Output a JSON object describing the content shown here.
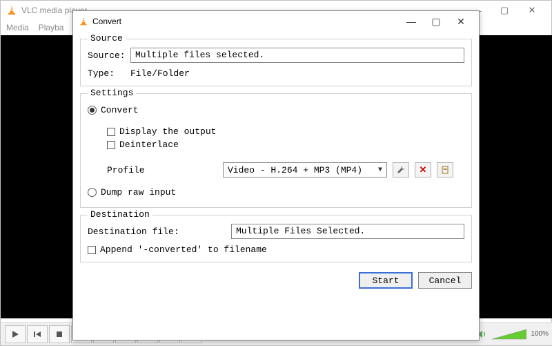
{
  "main": {
    "title": "VLC media player",
    "menu": [
      "Media",
      "Playba"
    ],
    "volume_percent": "100%"
  },
  "dialog": {
    "title": "Convert",
    "source": {
      "group_label": "Source",
      "source_label": "Source:",
      "source_value": "Multiple files selected.",
      "type_label": "Type:",
      "type_value": "File/Folder"
    },
    "settings": {
      "group_label": "Settings",
      "convert_label": "Convert",
      "display_output_label": "Display the output",
      "deinterlace_label": "Deinterlace",
      "profile_label": "Profile",
      "profile_value": "Video - H.264 + MP3 (MP4)",
      "dump_label": "Dump raw input"
    },
    "destination": {
      "group_label": "Destination",
      "file_label": "Destination file:",
      "file_value": "Multiple Files Selected.",
      "append_label": "Append '-converted' to filename"
    },
    "buttons": {
      "start": "Start",
      "cancel": "Cancel"
    }
  }
}
